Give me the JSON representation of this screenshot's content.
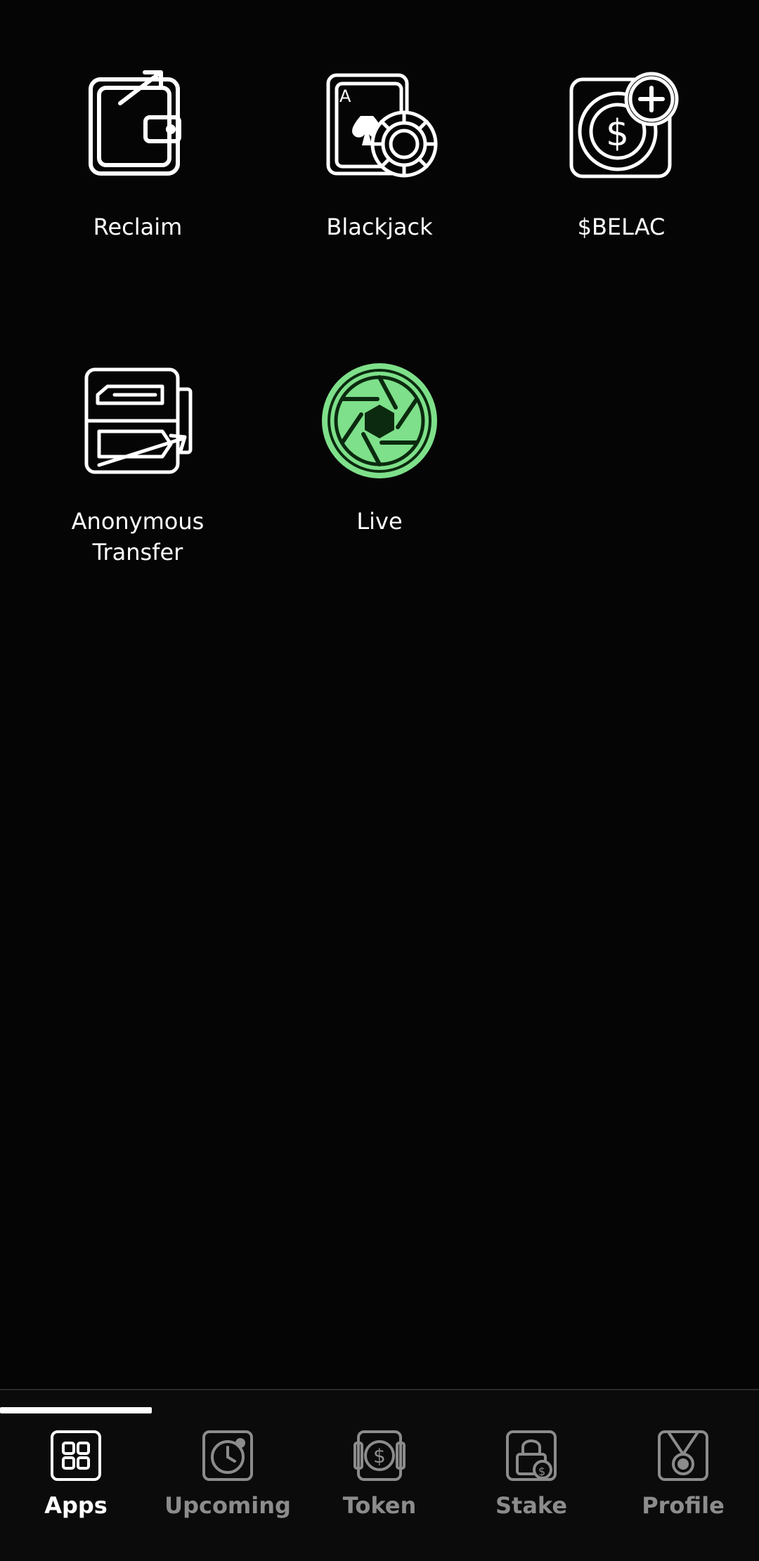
{
  "apps": [
    {
      "label": "Reclaim",
      "icon": "wallet-arrow-icon"
    },
    {
      "label": "Blackjack",
      "icon": "playing-card-chip-icon"
    },
    {
      "label": "$BELAC",
      "icon": "dollar-coin-plus-icon"
    },
    {
      "label": "Anonymous\nTransfer",
      "icon": "transfer-arrows-icon"
    },
    {
      "label": "Live",
      "icon": "camera-aperture-icon"
    }
  ],
  "tabbar": {
    "active": "Apps",
    "tabs": [
      {
        "label": "Apps",
        "icon": "apps-grid-icon"
      },
      {
        "label": "Upcoming",
        "icon": "clock-icon"
      },
      {
        "label": "Token",
        "icon": "dollar-token-icon"
      },
      {
        "label": "Stake",
        "icon": "lock-dollar-icon"
      },
      {
        "label": "Profile",
        "icon": "medal-icon"
      }
    ]
  },
  "colors": {
    "background": "#050505",
    "live_accent": "#7ee08a",
    "inactive_tab": "#8c8c8c"
  }
}
